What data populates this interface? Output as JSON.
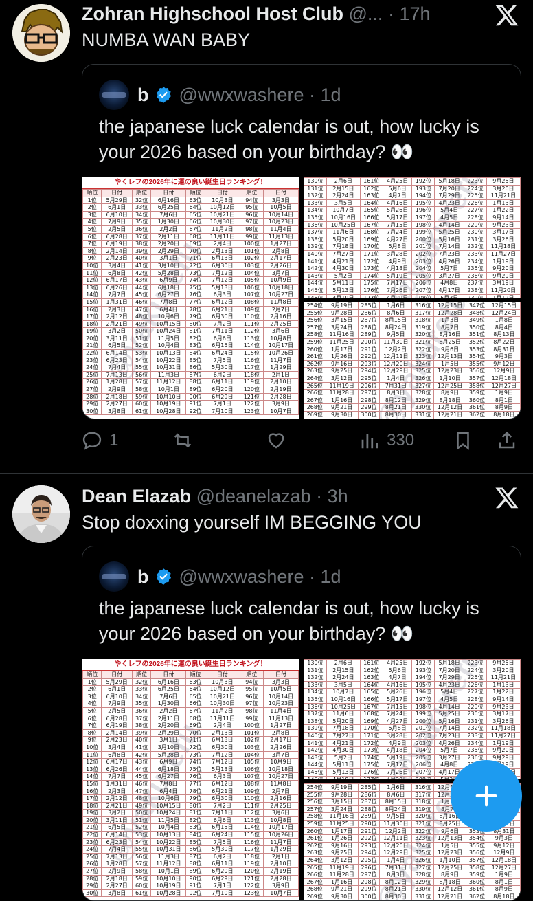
{
  "tweets": [
    {
      "author": "Zohran Highschool Host Club",
      "handle": "@...",
      "time": "17h",
      "text": "NUMBA WAN BABY",
      "quote": {
        "author": "b",
        "handle": "@wwxwashere",
        "time": "1d",
        "text": "the japanese luck calendar is out, how lucky is your 2026 based on your birthday? 👀"
      },
      "actions": {
        "replies": "1",
        "retweets": "",
        "likes": "",
        "views": "330"
      }
    },
    {
      "author": "Dean Elazab",
      "handle": "@deanelazab",
      "time": "3h",
      "text": "Stop doxxing yourself IM BEGGING YOU",
      "quote": {
        "author": "b",
        "handle": "@wwxwashere",
        "time": "1d",
        "text": "the japanese luck calendar is out, how lucky is your 2026 based on your birthday? 👀"
      }
    }
  ],
  "calendar": {
    "title": "やくレフの2026年に運の良い誕生日ランキング！",
    "headers": [
      "順位",
      "日付",
      "順位",
      "日付",
      "順位",
      "日付",
      "順位",
      "日付"
    ],
    "rows": [
      [
        "1位",
        "5月29日",
        "32位",
        "6月16日",
        "63位",
        "10月3日",
        "94位",
        "3月3日"
      ],
      [
        "2位",
        "6月1日",
        "33位",
        "6月25日",
        "64位",
        "10月12日",
        "95位",
        "10月5日"
      ],
      [
        "3位",
        "6月10日",
        "34位",
        "7月6日",
        "65位",
        "10月21日",
        "96位",
        "10月14日"
      ],
      [
        "4位",
        "7月9日",
        "35位",
        "1月30日",
        "66位",
        "10月30日",
        "97位",
        "10月23日"
      ],
      [
        "5位",
        "2月5日",
        "36位",
        "2月2日",
        "67位",
        "11月2日",
        "98位",
        "11月4日"
      ],
      [
        "6位",
        "6月28日",
        "37位",
        "2月11日",
        "68位",
        "11月11日",
        "99位",
        "11月13日"
      ],
      [
        "7位",
        "6月19日",
        "38位",
        "2月20日",
        "69位",
        "2月4日",
        "100位",
        "1月27日"
      ],
      [
        "8位",
        "2月14日",
        "39位",
        "2月29日",
        "70位",
        "2月13日",
        "101位",
        "2月8日"
      ],
      [
        "9位",
        "2月23日",
        "40位",
        "3月1日",
        "71位",
        "6月13日",
        "102位",
        "2月17日"
      ],
      [
        "10位",
        "3月4日",
        "41位",
        "3月10日",
        "72位",
        "6月30日",
        "103位",
        "2月26日"
      ],
      [
        "11位",
        "6月8日",
        "42位",
        "5月28日",
        "73位",
        "7月12日",
        "104位",
        "3月7日"
      ],
      [
        "12位",
        "6月17日",
        "43位",
        "6月9日",
        "74位",
        "7月12日",
        "105位",
        "10月9日"
      ],
      [
        "13位",
        "6月26日",
        "44位",
        "6月18日",
        "75位",
        "5月13日",
        "106位",
        "10月18日"
      ],
      [
        "14位",
        "7月7日",
        "45位",
        "6月27日",
        "76位",
        "6月3日",
        "107位",
        "10月27日"
      ],
      [
        "15位",
        "1月31日",
        "46位",
        "7月8日",
        "77位",
        "6月12日",
        "108位",
        "11月8日"
      ],
      [
        "16位",
        "2月3日",
        "47位",
        "6月4日",
        "78位",
        "6月21日",
        "109位",
        "2月7日"
      ],
      [
        "17位",
        "2月12日",
        "48位",
        "10月6日",
        "79位",
        "6月30日",
        "110位",
        "2月16日"
      ],
      [
        "18位",
        "2月21日",
        "49位",
        "10月15日",
        "80位",
        "7月2日",
        "111位",
        "2月25日"
      ],
      [
        "19位",
        "3月2日",
        "50位",
        "10月24日",
        "81位",
        "7月11日",
        "112位",
        "3月6日"
      ],
      [
        "20位",
        "3月11日",
        "51位",
        "11月5日",
        "82位",
        "6月6日",
        "113位",
        "10月8日"
      ],
      [
        "21位",
        "6月5日",
        "52位",
        "10月4日",
        "83位",
        "6月15日",
        "114位",
        "10月17日"
      ],
      [
        "22位",
        "6月14日",
        "53位",
        "10月13日",
        "84位",
        "6月24日",
        "115位",
        "10月26日"
      ],
      [
        "23位",
        "6月23日",
        "54位",
        "10月22日",
        "85位",
        "7月5日",
        "116位",
        "11月7日"
      ],
      [
        "24位",
        "7月4日",
        "55位",
        "10月31日",
        "86位",
        "5月30日",
        "117位",
        "1月29日"
      ],
      [
        "25位",
        "7月13日",
        "56位",
        "11月3日",
        "87位",
        "6月2日",
        "118位",
        "2月1日"
      ],
      [
        "26位",
        "1月28日",
        "57位",
        "11月12日",
        "88位",
        "6月11日",
        "119位",
        "2月10日"
      ],
      [
        "27位",
        "2月9日",
        "58位",
        "10月1日",
        "89位",
        "6月20日",
        "120位",
        "2月19日"
      ],
      [
        "28位",
        "2月18日",
        "59位",
        "10月10日",
        "90位",
        "6月29日",
        "121位",
        "2月28日"
      ],
      [
        "29位",
        "2月27日",
        "60位",
        "10月19日",
        "91位",
        "7月1日",
        "122位",
        "3月9日"
      ],
      [
        "30位",
        "3月8日",
        "61位",
        "10月28日",
        "92位",
        "7月10日",
        "123位",
        "10月7日"
      ]
    ],
    "rows_top_right": [
      [
        "130位",
        "2月6日",
        "161位",
        "4月25日",
        "192位",
        "5月18日",
        "223位",
        "9月25日"
      ],
      [
        "131位",
        "2月15日",
        "162位",
        "5月6日",
        "193位",
        "7月20日",
        "224位",
        "3月20日"
      ],
      [
        "132位",
        "2月24日",
        "163位",
        "4月7日",
        "194位",
        "7月29日",
        "225位",
        "11月21日"
      ],
      [
        "133位",
        "3月5日",
        "164位",
        "4月16日",
        "195位",
        "4月23日",
        "226位",
        "1月13日"
      ],
      [
        "134位",
        "10月7日",
        "165位",
        "5月26日",
        "196位",
        "5月4日",
        "227位",
        "1月22日"
      ],
      [
        "135位",
        "10月16日",
        "166位",
        "5月17日",
        "197位",
        "4月5日",
        "228位",
        "9月14日"
      ],
      [
        "136位",
        "10月25日",
        "167位",
        "7月15日",
        "198位",
        "4月14日",
        "229位",
        "9月23日"
      ],
      [
        "137位",
        "11月6日",
        "168位",
        "7月24日",
        "199位",
        "5月25日",
        "230位",
        "3月17日"
      ],
      [
        "138位",
        "5月20日",
        "169位",
        "4月27日",
        "200位",
        "5月16日",
        "231位",
        "3月26日"
      ],
      [
        "139位",
        "7月18日",
        "170位",
        "5月8日",
        "201位",
        "7月14日",
        "232位",
        "11月18日"
      ],
      [
        "140位",
        "7月27日",
        "171位",
        "3月28日",
        "202位",
        "7月23日",
        "233位",
        "11月27日"
      ],
      [
        "141位",
        "4月21日",
        "172位",
        "4月9日",
        "203位",
        "4月26日",
        "234位",
        "1月19日"
      ],
      [
        "142位",
        "4月30日",
        "173位",
        "4月18日",
        "204位",
        "5月7日",
        "235位",
        "9月20日"
      ],
      [
        "143位",
        "5月2日",
        "174位",
        "5月19日",
        "205位",
        "3月27日",
        "236位",
        "9月29日"
      ],
      [
        "144位",
        "5月11日",
        "175位",
        "7月17日",
        "206位",
        "4月8日",
        "237位",
        "3月19日"
      ],
      [
        "145位",
        "5月13日",
        "176位",
        "7月26日",
        "207位",
        "4月17日",
        "238位",
        "11月20日"
      ],
      [
        "146位",
        "4月19日",
        "177位",
        "4月29日",
        "208位",
        "5月3日",
        "239位",
        "1月12日"
      ],
      [
        "147位",
        "4月28日",
        "178位",
        "5月1日",
        "209位",
        "5月21日",
        "240位",
        "1月21日"
      ]
    ],
    "rows_bottom_right": [
      [
        "254位",
        "9月19日",
        "285位",
        "1月6日",
        "316位",
        "12月15日",
        "347位",
        "12月15日"
      ],
      [
        "255位",
        "9月28日",
        "286位",
        "8月6日",
        "317位",
        "12月28日",
        "348位",
        "12月24日"
      ],
      [
        "256位",
        "3月15日",
        "287位",
        "8月15日",
        "318位",
        "1月3日",
        "349位",
        "1月8日"
      ],
      [
        "257位",
        "3月24日",
        "288位",
        "8月24日",
        "319位",
        "8月7日",
        "350位",
        "8月4日"
      ],
      [
        "258位",
        "11月16日",
        "289位",
        "9月5日",
        "320位",
        "8月16日",
        "351位",
        "8月13日"
      ],
      [
        "259位",
        "11月25日",
        "290位",
        "11月30日",
        "321位",
        "8月25日",
        "352位",
        "8月22日"
      ],
      [
        "260位",
        "1月17日",
        "291位",
        "12月2日",
        "322位",
        "9月6日",
        "353位",
        "8月31日"
      ],
      [
        "261位",
        "1月26日",
        "292位",
        "12月11日",
        "323位",
        "12月13日",
        "354位",
        "9月3日"
      ],
      [
        "262位",
        "9月16日",
        "293位",
        "12月20日",
        "324位",
        "1月5日",
        "355位",
        "9月12日"
      ],
      [
        "263位",
        "9月25日",
        "294位",
        "12月29日",
        "325位",
        "12月23日",
        "356位",
        "12月9日"
      ],
      [
        "264位",
        "3月12日",
        "295位",
        "1月4日",
        "326位",
        "1月10日",
        "357位",
        "12月18日"
      ],
      [
        "265位",
        "11月19日",
        "296位",
        "7月31日",
        "327位",
        "12月25日",
        "358位",
        "12月27日"
      ],
      [
        "266位",
        "11月28日",
        "297位",
        "8月3日",
        "328位",
        "8月9日",
        "359位",
        "1月9日"
      ],
      [
        "267位",
        "1月16日",
        "298位",
        "8月12日",
        "329位",
        "8月18日",
        "360位",
        "8月1日"
      ],
      [
        "268位",
        "9月21日",
        "299位",
        "8月21日",
        "330位",
        "12月12日",
        "361位",
        "8月9日"
      ],
      [
        "269位",
        "9月30日",
        "300位",
        "8月30日",
        "331位",
        "12月21日",
        "362位",
        "8月18日"
      ],
      [
        "270位",
        "3月14日",
        "301位",
        "9月2日",
        "332位",
        "7月30日",
        "363位",
        "8月27日"
      ]
    ],
    "watermark": "@yakurefu"
  }
}
